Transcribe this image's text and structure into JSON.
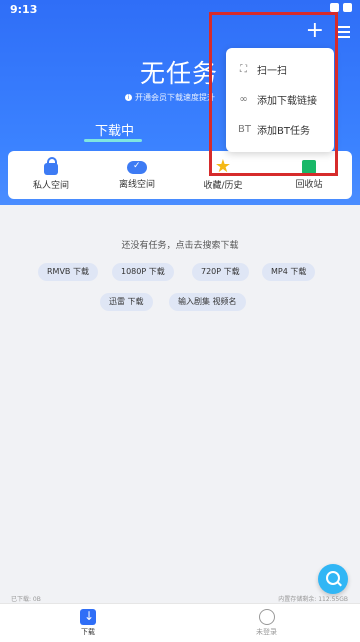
{
  "status": {
    "time": "9:13"
  },
  "header": {
    "title": "无任务",
    "hint": "开通会员下载速度提升",
    "tab_label": "下载中"
  },
  "quick_actions": [
    {
      "label": "私人空间",
      "icon": "lock-icon"
    },
    {
      "label": "离线空间",
      "icon": "cloud-check-icon"
    },
    {
      "label": "收藏/历史",
      "icon": "star-icon"
    },
    {
      "label": "回收站",
      "icon": "trash-icon"
    }
  ],
  "empty_state": {
    "message": "还没有任务，点击去搜索下载",
    "chips": [
      "RMVB 下载",
      "1080P 下载",
      "720P 下载",
      "MP4 下载",
      "迅雷 下载",
      "输入剧集 视频名"
    ]
  },
  "footer_info": {
    "downloaded": "已下载: 0B",
    "storage": "内置存储剩余: 112.55GB"
  },
  "bottom_nav": [
    {
      "label": "下载",
      "icon": "download-icon"
    },
    {
      "label": "未登录",
      "icon": "user-icon"
    }
  ],
  "popup_menu": [
    {
      "label": "扫一扫",
      "icon": "scan-icon"
    },
    {
      "label": "添加下载链接",
      "icon": "link-icon"
    },
    {
      "label": "添加BT任务",
      "icon": "bt-icon",
      "glyph": "BT"
    }
  ],
  "colors": {
    "primary": "#2f6ef7",
    "highlight_border": "#d62b2b",
    "fab": "#31b6f5"
  }
}
